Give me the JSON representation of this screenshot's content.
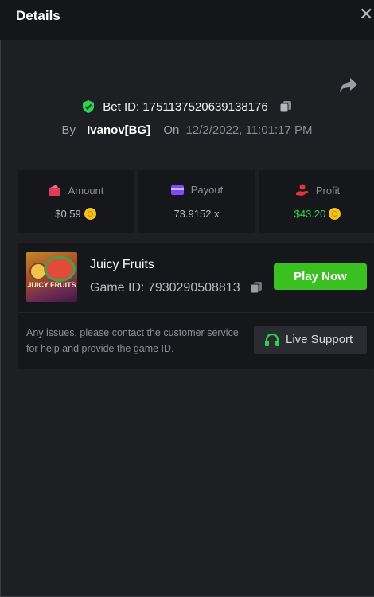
{
  "header": {
    "title": "Details",
    "close_icon": "close-icon",
    "share_icon": "share-arrow-icon"
  },
  "bet": {
    "id_label": "Bet ID:",
    "id": "1751137520639138176",
    "by_label": "By",
    "user": "Ivanov[BG]",
    "on_label": "On",
    "datetime": "12/2/2022, 11:01:17 PM",
    "verified_icon": "shield-check-icon",
    "copy_icon": "copy-icon"
  },
  "stats": {
    "amount": {
      "label": "Amount",
      "value": "$0.59",
      "icon": "wallet-icon",
      "currency_icon": "coin-icon"
    },
    "payout": {
      "label": "Payout",
      "value": "73.9152 x",
      "icon": "card-icon"
    },
    "profit": {
      "label": "Profit",
      "value": "$43.20",
      "icon": "hand-coin-icon",
      "currency_icon": "coin-icon"
    }
  },
  "game": {
    "thumb_text": "JUICY FRUITS",
    "name": "Juicy Fruits",
    "id_label": "Game ID:",
    "id": "7930290508813",
    "play_label": "Play Now"
  },
  "support": {
    "note": "Any issues, please contact the customer service for help and provide the game ID.",
    "button_label": "Live Support",
    "icon": "headset-icon"
  },
  "colors": {
    "accent_green": "#3bc022",
    "profit_green": "#33d04b",
    "coin": "#f4c21a"
  }
}
